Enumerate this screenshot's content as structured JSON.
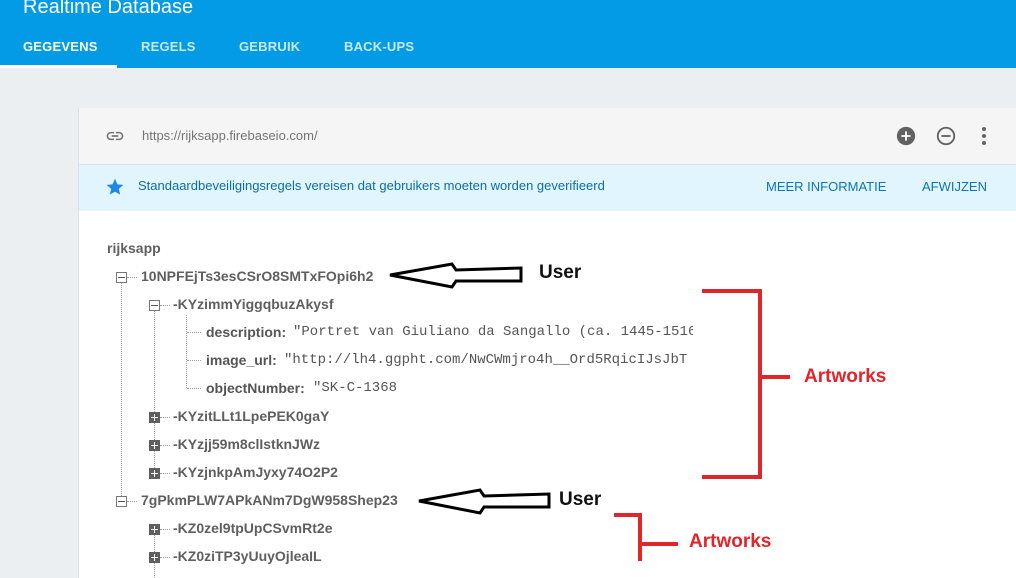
{
  "app": {
    "title": "Realtime Database"
  },
  "tabs": [
    {
      "label": "GEGEVENS",
      "active": true
    },
    {
      "label": "REGELS"
    },
    {
      "label": "GEBRUIK"
    },
    {
      "label": "BACK-UPS"
    }
  ],
  "toolbar": {
    "url": "https://rijksapp.firebaseio.com/",
    "icons": [
      "link-icon",
      "add-circle-icon",
      "remove-circle-icon",
      "more-vert-icon"
    ]
  },
  "banner": {
    "icon": "star-icon",
    "text": "Standaardbeveiligingsregels vereisen dat gebruikers moeten worden geverifieerd",
    "more_info_label": "MEER INFORMATIE",
    "dismiss_label": "AFWIJZEN"
  },
  "tree": {
    "root": "rijksapp",
    "users": [
      {
        "key": "10NPFEjTs3esCSrO8SMTxFOpi6h2",
        "expanded": true,
        "artworks": [
          {
            "key": "-KYzimmYiggqbuzAkysf",
            "expanded": true,
            "props": [
              {
                "key": "description:",
                "value": "\"Portret van Giuliano da Sangallo (ca. 1445-1516"
              },
              {
                "key": "image_url:",
                "value": "\"http://lh4.ggpht.com/NwCWmjro4h__Ord5RqicIJsJbT"
              },
              {
                "key": "objectNumber:",
                "value": "\"SK-C-1368"
              }
            ]
          },
          {
            "key": "-KYzitLLt1LpePEK0gaY",
            "expanded": false
          },
          {
            "key": "-KYzjj59m8clIstknJWz",
            "expanded": false
          },
          {
            "key": "-KYzjnkpAmJyxy74O2P2",
            "expanded": false
          }
        ]
      },
      {
        "key": "7gPkmPLW7APkANm7DgW958Shep23",
        "expanded": true,
        "artworks": [
          {
            "key": "-KZ0zel9tpUpCSvmRt2e",
            "expanded": false
          },
          {
            "key": "-KZ0ziTP3yUuyOjleaIL",
            "expanded": false
          }
        ]
      }
    ]
  },
  "annotations": {
    "user_label_1": "User",
    "user_label_2": "User",
    "artworks_label_1": "Artworks",
    "artworks_label_2": "Artworks",
    "arrow_color": "#000000",
    "bracket_color": "#e0262b"
  }
}
